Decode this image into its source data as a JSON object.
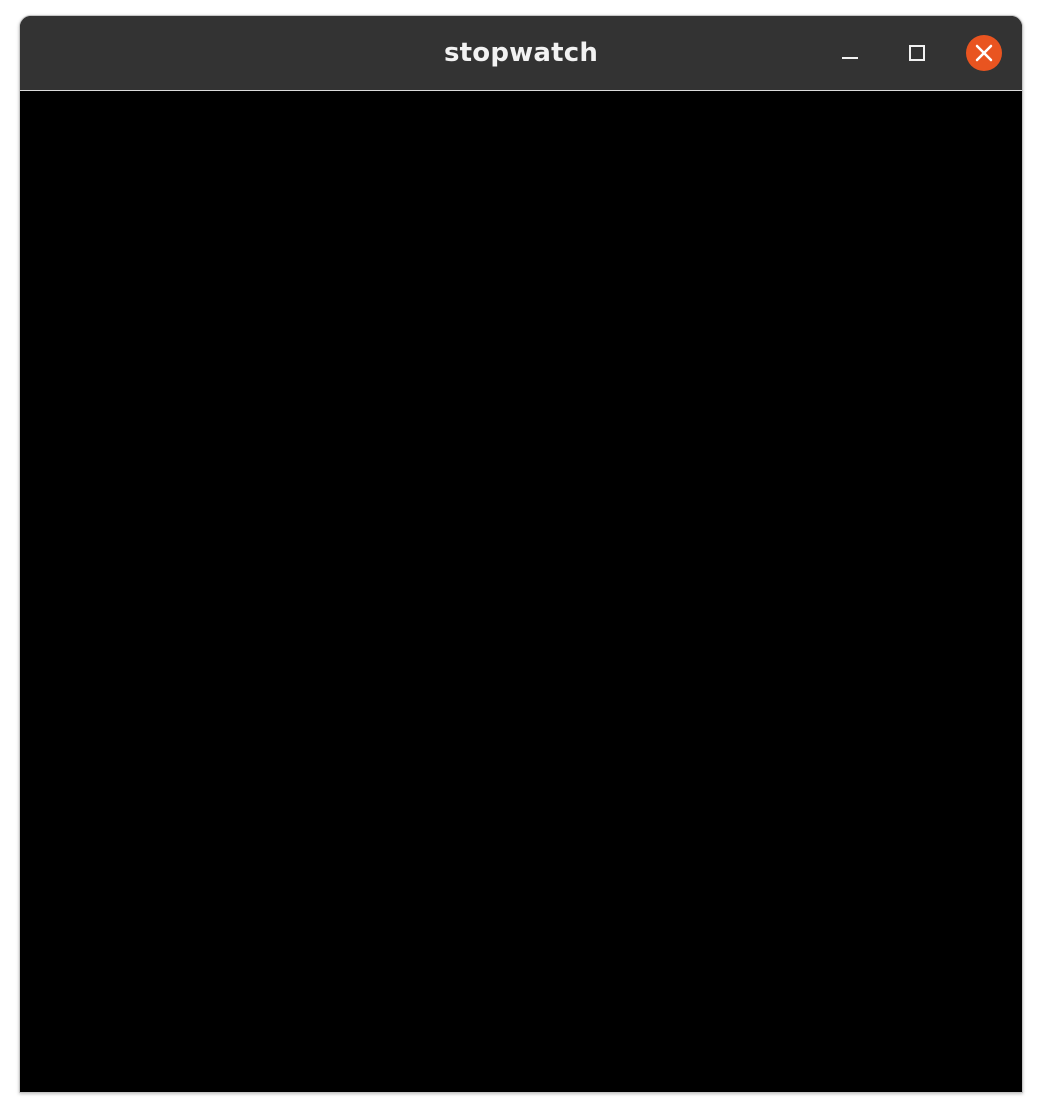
{
  "window": {
    "title": "stopwatch"
  },
  "controls": {
    "minimize_icon": "minimize-icon",
    "maximize_icon": "maximize-icon",
    "close_icon": "close-icon",
    "close_color": "#e95420"
  },
  "content": {
    "background": "#000000"
  }
}
